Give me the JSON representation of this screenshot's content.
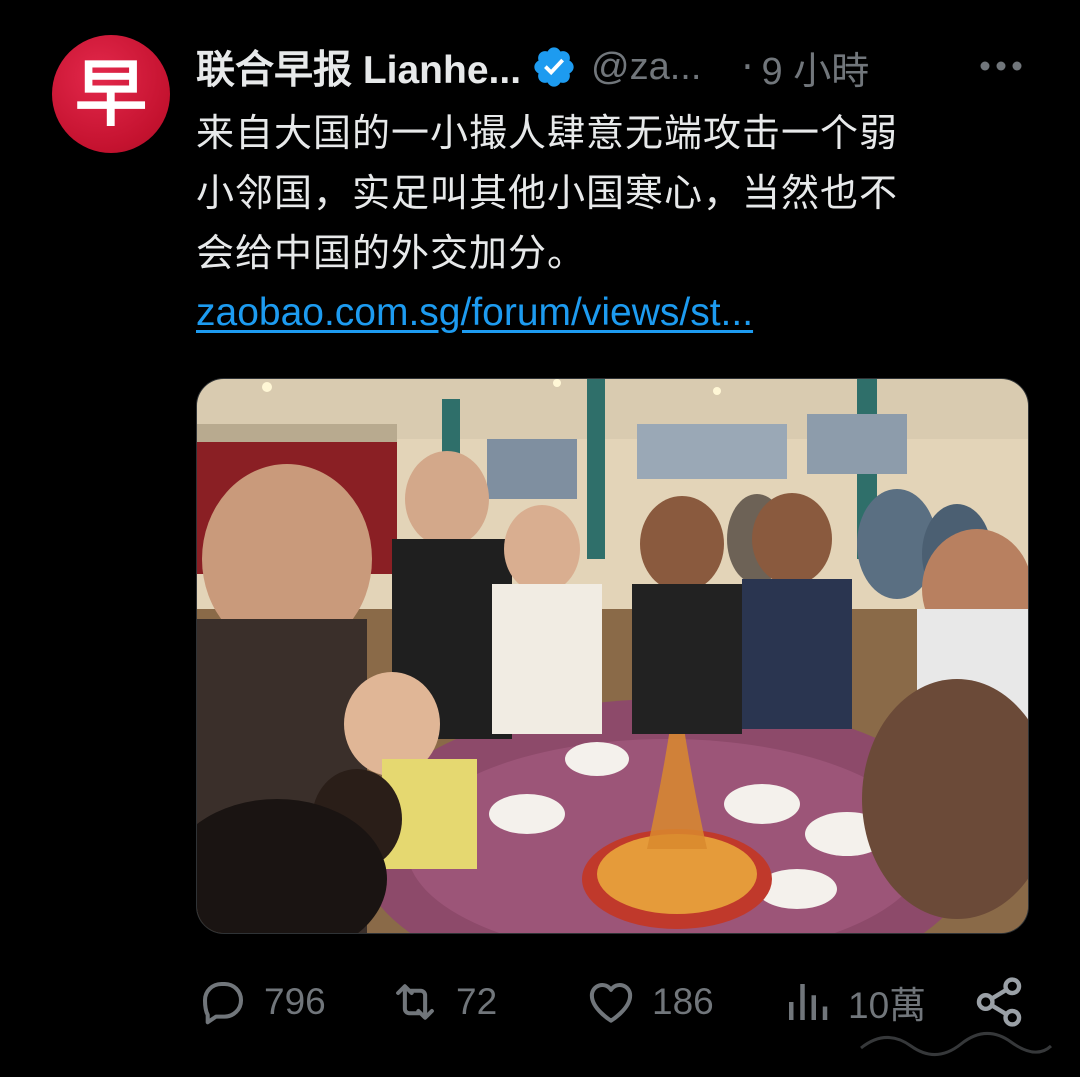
{
  "tweet": {
    "avatar_glyph": "早",
    "display_name": "联合早报 Lianhe...",
    "handle": "@za...",
    "separator": "·",
    "time": "9 小時",
    "text_lines": [
      "来自大国的一小撮人肆意无端攻击一个弱",
      "小邻国，实足叫其他小国寒心，当然也不",
      "会给中国的外交加分。"
    ],
    "link": "zaobao.com.sg/forum/views/st..."
  },
  "actions": {
    "replies": "796",
    "retweets": "72",
    "likes": "186",
    "views": "10萬"
  },
  "colors": {
    "background": "#000000",
    "text": "#e7e9ea",
    "muted": "#71767b",
    "link": "#1d9bf0",
    "verified": "#1d9bf0",
    "avatar": "#c4122f"
  },
  "icons": {
    "more": "more-horizontal-icon",
    "verified": "verified-badge-icon",
    "reply": "reply-icon",
    "retweet": "retweet-icon",
    "like": "heart-icon",
    "views": "views-bar-chart-icon",
    "share": "share-icon"
  }
}
